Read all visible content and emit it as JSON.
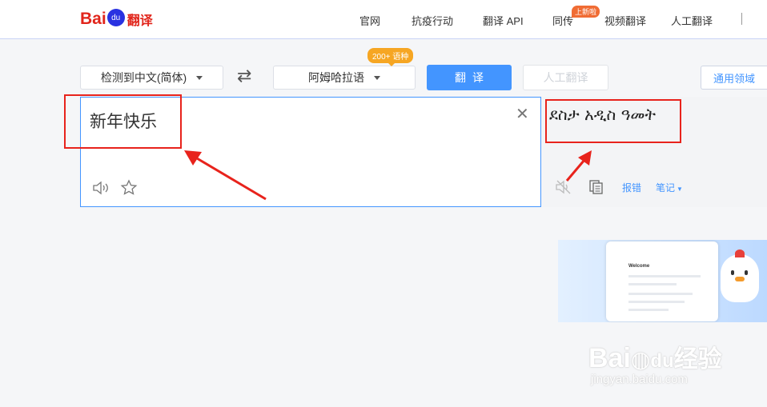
{
  "header": {
    "logo": {
      "brand": "Bai",
      "paw_text": "du",
      "product": "翻译"
    },
    "nav": [
      "官网",
      "抗疫行动",
      "翻译 API",
      "同传",
      "视频翻译",
      "人工翻译"
    ],
    "new_badge": "上新啦"
  },
  "toolbar": {
    "source_lang": "检测到中文(简体)",
    "target_lang": "阿姆哈拉语",
    "lang_count_badge": "200+ 语种",
    "translate_label": "翻译",
    "human_translate_label": "人工翻译",
    "domain_label": "通用领域"
  },
  "input": {
    "value": "新年快乐"
  },
  "output": {
    "text": "ደስታ አዲስ ዓመት",
    "report_label": "报错",
    "notes_label": "笔记"
  },
  "watermark": {
    "brand": "Bai",
    "du": "du",
    "product": "经验",
    "url": "jingyan.baidu.com"
  },
  "promo": {
    "welcome": "Welcome"
  },
  "colors": {
    "accent": "#4395ff",
    "annotation": "#e8231c",
    "brand_red": "#e1251b",
    "badge_orange": "#f6a623"
  }
}
